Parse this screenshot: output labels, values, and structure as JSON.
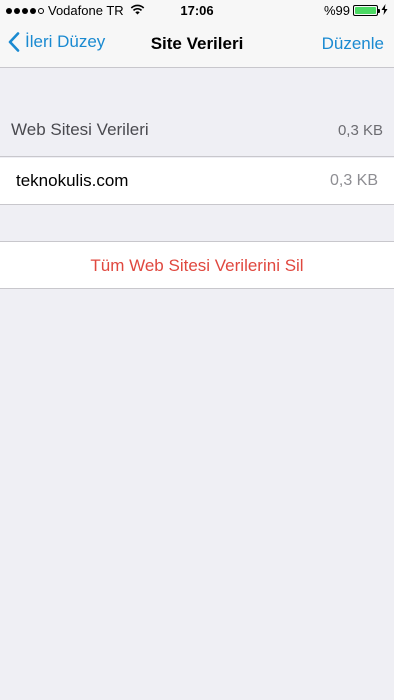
{
  "status_bar": {
    "carrier": "Vodafone TR",
    "time": "17:06",
    "battery_percent": "%99",
    "battery_level": 0.99,
    "signal_bars_filled": 4,
    "signal_bars_total": 5,
    "battery_color": "#4cd964"
  },
  "nav": {
    "back_label": "İleri Düzey",
    "title": "Site Verileri",
    "edit_label": "Düzenle",
    "accent_color": "#1a8ad1"
  },
  "section": {
    "header_label": "Web Sitesi Verileri",
    "header_value": "0,3 KB"
  },
  "rows": [
    {
      "label": "teknokulis.com",
      "value": "0,3 KB"
    }
  ],
  "delete": {
    "label": "Tüm Web Sitesi Verilerini Sil",
    "color": "#e0483f"
  }
}
